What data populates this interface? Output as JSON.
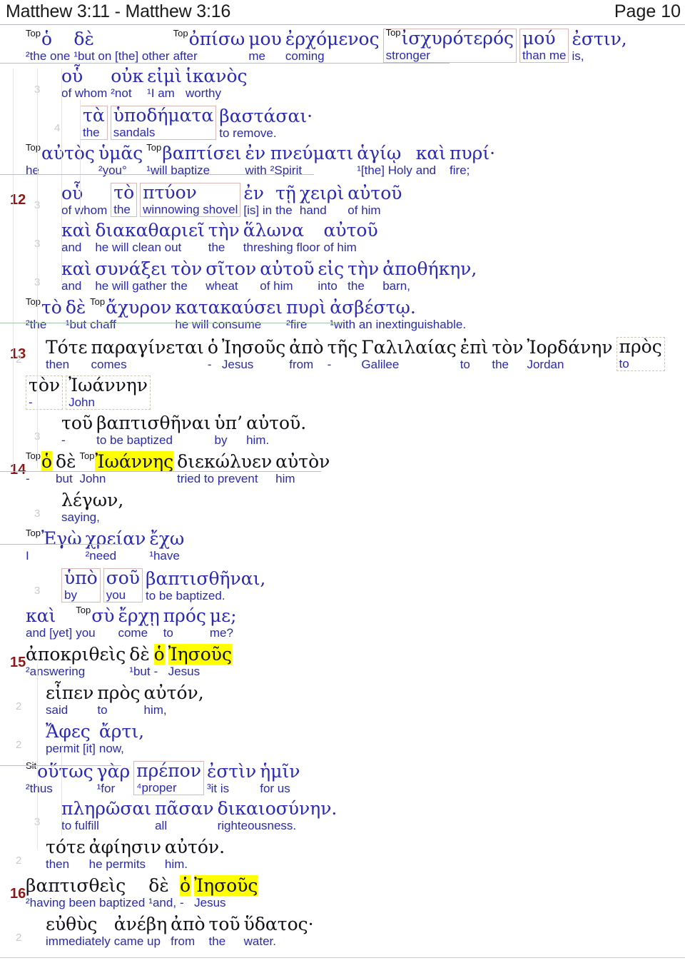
{
  "header": {
    "title": "Matthew 3:11 - Matthew 3:16",
    "page_label": "Page 10"
  },
  "colors": {
    "greek_blue": "#2a2ab0",
    "greek_black": "#101018",
    "english_blue": "#2a2ab0",
    "verse_number": "#8c1818",
    "highlight": "#ffff00",
    "box_border": "#d9b8b8",
    "guide_line": "#e3e3e8",
    "header_text": "#1a1a1a"
  },
  "tags": {
    "top": "Top",
    "sit": "Sit"
  },
  "rows": [
    {
      "id": "r1",
      "verse": "",
      "indent": "",
      "cells": [
        {
          "tag": "Top",
          "gk": "ὁ",
          "en": "²the one"
        },
        {
          "gk": "δὲ",
          "en": "¹but on [the] other"
        },
        {
          "tag": "Top",
          "gk": "ὀπίσω",
          "en": "after"
        },
        {
          "gk": "μου",
          "en": "me"
        },
        {
          "gk": "ἐρχόμενος",
          "en": "coming"
        },
        {
          "tag": "Top",
          "gk": "ἰσχυρότερός",
          "en": "stronger",
          "box": "solid"
        },
        {
          "gk": "μού",
          "en": "than me",
          "box": "solid-cont"
        },
        {
          "gk": "ἐστιν,",
          "en": "is,"
        }
      ]
    },
    {
      "id": "r2",
      "verse": "",
      "indent": "3",
      "cells": [
        {
          "gk": "οὗ",
          "en": "of whom"
        },
        {
          "gk": "οὐκ",
          "en": "²not"
        },
        {
          "gk": "εἰμὶ",
          "en": "¹I am"
        },
        {
          "gk": "ἱκανὸς",
          "en": "worthy"
        }
      ]
    },
    {
      "id": "r3",
      "verse": "",
      "indent": "4",
      "cells": [
        {
          "gk": "τὰ",
          "en": "the",
          "box": "solid"
        },
        {
          "gk": "ὑποδήματα",
          "en": "sandals",
          "box": "solid-cont"
        },
        {
          "gk": "βαστάσαι·",
          "en": "to remove."
        }
      ]
    },
    {
      "id": "r4",
      "verse": "",
      "indent": "",
      "cells": [
        {
          "tag": "Top",
          "gk": "αὐτὸς",
          "en": "he"
        },
        {
          "gk": "ὑμᾶς",
          "en": "²you°"
        },
        {
          "tag": "Top",
          "gk": "βαπτίσει",
          "en": "¹will baptize"
        },
        {
          "gk": "ἐν",
          "en": "with"
        },
        {
          "gk": "πνεύματι",
          "en": "²Spirit"
        },
        {
          "gk": "ἁγίῳ",
          "en": "¹[the] Holy"
        },
        {
          "gk": "καὶ",
          "en": "and"
        },
        {
          "gk": "πυρί·",
          "en": "fire;"
        }
      ]
    },
    {
      "id": "r5",
      "verse": "12",
      "indent": "3",
      "cells": [
        {
          "gk": "οὗ",
          "en": "of whom"
        },
        {
          "gk": "τὸ",
          "en": "the",
          "box": "solid"
        },
        {
          "gk": "πτύον",
          "en": "winnowing shovel",
          "box": "solid-cont"
        },
        {
          "gk": "ἐν",
          "en": "[is] in"
        },
        {
          "gk": "τῇ",
          "en": "the"
        },
        {
          "gk": "χειρὶ",
          "en": "hand"
        },
        {
          "gk": "αὐτοῦ",
          "en": "of him"
        }
      ]
    },
    {
      "id": "r6",
      "verse": "",
      "indent": "3",
      "cells": [
        {
          "gk": "καὶ",
          "en": "and"
        },
        {
          "gk": "διακαθαριεῖ",
          "en": "he will clean out"
        },
        {
          "gk": "τὴν",
          "en": "the"
        },
        {
          "gk": "ἅλωνα",
          "en": "threshing floor"
        },
        {
          "gk": "αὐτοῦ",
          "en": "of him"
        }
      ]
    },
    {
      "id": "r7",
      "verse": "",
      "indent": "3",
      "cells": [
        {
          "gk": "καὶ",
          "en": "and"
        },
        {
          "gk": "συνάξει",
          "en": "he will gather"
        },
        {
          "gk": "τὸν",
          "en": "the"
        },
        {
          "gk": "σῖτον",
          "en": "wheat"
        },
        {
          "gk": "αὐτοῦ",
          "en": "of him"
        },
        {
          "gk": "εἰς",
          "en": "into"
        },
        {
          "gk": "τὴν",
          "en": "the"
        },
        {
          "gk": "ἀποθήκην,",
          "en": "barn,"
        }
      ]
    },
    {
      "id": "r8",
      "verse": "",
      "indent": "",
      "cells": [
        {
          "tag": "Top",
          "gk": "τὸ",
          "en": "²the"
        },
        {
          "gk": "δὲ",
          "en": "¹but"
        },
        {
          "tag": "Top",
          "gk": "ἄχυρον",
          "en": "chaff"
        },
        {
          "gk": "κατακαύσει",
          "en": "he will consume"
        },
        {
          "gk": "πυρὶ",
          "en": "²fire"
        },
        {
          "gk": "ἀσβέστῳ.",
          "en": "¹with an inextinguishable."
        }
      ]
    },
    {
      "id": "r9",
      "verse": "13",
      "indent": "2",
      "black": true,
      "cells": [
        {
          "gk": "Τότε",
          "en": "then"
        },
        {
          "gk": "παραγίνεται",
          "en": "comes"
        },
        {
          "gk": "ὁ",
          "en": "-"
        },
        {
          "gk": "Ἰησοῦς",
          "en": "Jesus"
        },
        {
          "gk": "ἀπὸ",
          "en": "from"
        },
        {
          "gk": "τῆς",
          "en": "-"
        },
        {
          "gk": "Γαλιλαίας",
          "en": "Galilee"
        },
        {
          "gk": "ἐπὶ",
          "en": "to"
        },
        {
          "gk": "τὸν",
          "en": "the"
        },
        {
          "gk": "Ἰορδάνην",
          "en": "Jordan"
        },
        {
          "gk": "πρὸς",
          "en": "to",
          "box": "dashed"
        }
      ]
    },
    {
      "id": "r10",
      "verse": "",
      "indent": "",
      "black": true,
      "cells": [
        {
          "gk": "τὸν",
          "en": "-",
          "box": "dashed"
        },
        {
          "gk": "Ἰωάννην",
          "en": "John",
          "box": "dashed-cont"
        }
      ]
    },
    {
      "id": "r11",
      "verse": "",
      "indent": "3",
      "black": true,
      "cells": [
        {
          "gk": "τοῦ",
          "en": "-"
        },
        {
          "gk": "βαπτισθῆναι",
          "en": "to be baptized"
        },
        {
          "gk": "ὑπ’",
          "en": "by"
        },
        {
          "gk": "αὐτοῦ.",
          "en": "him."
        }
      ]
    },
    {
      "id": "r12",
      "verse": "14",
      "indent": "",
      "black": true,
      "cells": [
        {
          "tag": "Top",
          "gk": "ὁ",
          "en": "-",
          "hl": true
        },
        {
          "gk": "δὲ",
          "en": "but"
        },
        {
          "tag": "Top",
          "gk": "Ἰωάννης",
          "en": "John",
          "hl": true
        },
        {
          "gk": "διεκώλυεν",
          "en": "tried to prevent"
        },
        {
          "gk": "αὐτὸν",
          "en": "him"
        }
      ]
    },
    {
      "id": "r13",
      "verse": "",
      "indent": "3",
      "black": true,
      "cells": [
        {
          "gk": "λέγων,",
          "en": "saying,"
        }
      ]
    },
    {
      "id": "r14",
      "verse": "",
      "indent": "",
      "cells": [
        {
          "tag": "Top",
          "gk": "Ἐγὼ",
          "en": "I"
        },
        {
          "gk": "χρείαν",
          "en": "²need"
        },
        {
          "gk": "ἔχω",
          "en": "¹have"
        }
      ]
    },
    {
      "id": "r15",
      "verse": "",
      "indent": "3",
      "cells": [
        {
          "gk": "ὑπὸ",
          "en": "by",
          "box": "solid"
        },
        {
          "gk": "σοῦ",
          "en": "you",
          "box": "solid-cont"
        },
        {
          "gk": "βαπτισθῆναι,",
          "en": "to be baptized."
        }
      ]
    },
    {
      "id": "r16",
      "verse": "",
      "indent": "",
      "cells": [
        {
          "gk": "καὶ",
          "en": "and [yet]"
        },
        {
          "tag": "Top",
          "gk": "σὺ",
          "en": "you"
        },
        {
          "gk": "ἔρχῃ",
          "en": "come"
        },
        {
          "gk": "πρός",
          "en": "to"
        },
        {
          "gk": "με;",
          "en": "me?"
        }
      ]
    },
    {
      "id": "r17",
      "verse": "15",
      "indent": "",
      "black": true,
      "cells": [
        {
          "gk": "ἀποκριθεὶς",
          "en": "²answering"
        },
        {
          "gk": "δὲ",
          "en": "¹but"
        },
        {
          "gk": "ὁ",
          "en": "-",
          "hl": true
        },
        {
          "gk": "Ἰησοῦς",
          "en": "Jesus",
          "hl": true
        }
      ]
    },
    {
      "id": "r18",
      "verse": "",
      "indent": "2",
      "black": true,
      "cells": [
        {
          "gk": "εἶπεν",
          "en": "said"
        },
        {
          "gk": "πρὸς",
          "en": "to"
        },
        {
          "gk": "αὐτόν,",
          "en": "him,"
        }
      ]
    },
    {
      "id": "r19",
      "verse": "",
      "indent": "2",
      "cells": [
        {
          "gk": "Ἄφες",
          "en": "permit [it]"
        },
        {
          "gk": "ἄρτι,",
          "en": "now,"
        }
      ]
    },
    {
      "id": "r20",
      "verse": "",
      "indent": "",
      "cells": [
        {
          "tag": "Sit",
          "gk": "οὕτως",
          "en": "²thus"
        },
        {
          "gk": "γὰρ",
          "en": "¹for"
        },
        {
          "gk": "πρέπον",
          "en": "⁴proper",
          "box": "solid"
        },
        {
          "gk": "ἐστὶν",
          "en": "³it is"
        },
        {
          "gk": "ἡμῖν",
          "en": "for us"
        }
      ]
    },
    {
      "id": "r21",
      "verse": "",
      "indent": "3",
      "cells": [
        {
          "gk": "πληρῶσαι",
          "en": "to fulfill"
        },
        {
          "gk": "πᾶσαν",
          "en": "all"
        },
        {
          "gk": "δικαιοσύνην.",
          "en": "righteousness."
        }
      ]
    },
    {
      "id": "r22",
      "verse": "",
      "indent": "2",
      "black": true,
      "cells": [
        {
          "gk": "τότε",
          "en": "then"
        },
        {
          "gk": "ἀφίησιν",
          "en": "he permits"
        },
        {
          "gk": "αὐτόν.",
          "en": "him."
        }
      ]
    },
    {
      "id": "r23",
      "verse": "16",
      "indent": "",
      "black": true,
      "cells": [
        {
          "gk": "βαπτισθεὶς",
          "en": "²having been baptized"
        },
        {
          "gk": "δὲ",
          "en": "¹and,"
        },
        {
          "gk": "ὁ",
          "en": "-",
          "hl": true
        },
        {
          "gk": "Ἰησοῦς",
          "en": "Jesus",
          "hl": true
        }
      ]
    },
    {
      "id": "r24",
      "verse": "",
      "indent": "2",
      "black": true,
      "cells": [
        {
          "gk": "εὐθὺς",
          "en": "immediately"
        },
        {
          "gk": "ἀνέβη",
          "en": "came up"
        },
        {
          "gk": "ἀπὸ",
          "en": "from"
        },
        {
          "gk": "τοῦ",
          "en": "the"
        },
        {
          "gk": "ὕδατος·",
          "en": "water."
        }
      ]
    }
  ]
}
